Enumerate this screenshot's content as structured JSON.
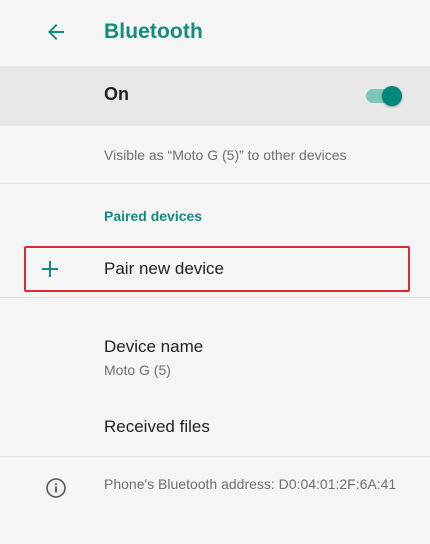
{
  "header": {
    "back_icon": "arrow-back-icon",
    "title": "Bluetooth"
  },
  "master_switch": {
    "label": "On",
    "state": "on",
    "accent_color": "#00897b"
  },
  "visibility_text": "Visible as “Moto G (5)” to other devices",
  "paired_devices": {
    "header": "Paired devices"
  },
  "pair_new_device": {
    "icon": "plus-icon",
    "label": "Pair new device"
  },
  "device_name": {
    "label": "Device name",
    "value": "Moto G (5)"
  },
  "received_files": {
    "label": "Received files"
  },
  "bluetooth_address": {
    "icon": "info-icon",
    "text": "Phone's Bluetooth address: D0:04:01:2F:6A:41"
  },
  "colors": {
    "accent_teal": "#128c7e",
    "highlight_border": "#d32f2f"
  }
}
